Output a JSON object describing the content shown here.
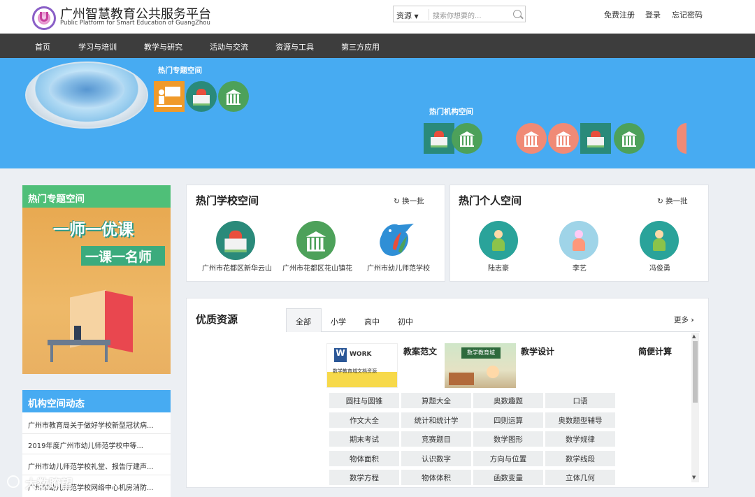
{
  "header": {
    "title": "广州智慧教育公共服务平台",
    "subtitle": "Public Platform for Smart Education of GuangZhou",
    "search_type": "资源",
    "search_placeholder": "搜索你想要的...",
    "links": [
      "免费注册",
      "登录",
      "忘记密码"
    ]
  },
  "nav": {
    "items": [
      "首页",
      "学习与培训",
      "教学与研究",
      "活动与交流",
      "资源与工具",
      "第三方应用"
    ]
  },
  "banner": {
    "hot_topic_label": "热门专题空间",
    "hot_org_label": "热门机构空间"
  },
  "sidebar": {
    "hot_topic_title": "热门专题空间",
    "poster_line1": "一师一优课",
    "poster_line2": "一课一名师",
    "org_news_title": "机构空间动态",
    "org_news": [
      "广州市教育局关于做好学校新型冠状病...",
      "2019年度广州市幼儿师范学校中等...",
      "广州市幼儿师范学校礼堂、报告厅建声...",
      "广州市幼儿师范学校网络中心机房消防..."
    ]
  },
  "schools": {
    "title": "热门学校空间",
    "refresh": "换一批",
    "items": [
      "广州市花都区新华云山",
      "广州市花都区花山镇花",
      "广州市幼儿师范学校"
    ]
  },
  "persons": {
    "title": "热门个人空间",
    "refresh": "换一批",
    "items": [
      "陆志豪",
      "李艺",
      "冯俊勇"
    ]
  },
  "resources": {
    "title": "优质资源",
    "tabs": [
      "全部",
      "小学",
      "高中",
      "初中"
    ],
    "active_tab": "全部",
    "more": "更多",
    "features": [
      {
        "label": "教案范文",
        "thumb_text": "WORK",
        "thumb_caption": "数学教育城文档资源"
      },
      {
        "label": "教学设计",
        "thumb_text": "数学教育城"
      },
      {
        "label": "简便计算"
      }
    ],
    "tags": [
      [
        "圆柱与圆锥",
        "算题大全",
        "奥数趣题",
        "口语"
      ],
      [
        "作文大全",
        "统计和统计学",
        "四则运算",
        "奥数题型辅导"
      ],
      [
        "期末考试",
        "竞赛题目",
        "数学图形",
        "数学规律"
      ],
      [
        "物体面积",
        "认识数字",
        "方向与位置",
        "数学线段"
      ],
      [
        "数学方程",
        "物体体积",
        "函数变量",
        "立体几何"
      ]
    ]
  },
  "watermark": "大数瞭望",
  "colors": {
    "nav_bg": "#3d3d3d",
    "banner_bg": "#47abf2",
    "hot_topic_head": "#4fbf78",
    "org_news_head": "#47abf2"
  }
}
